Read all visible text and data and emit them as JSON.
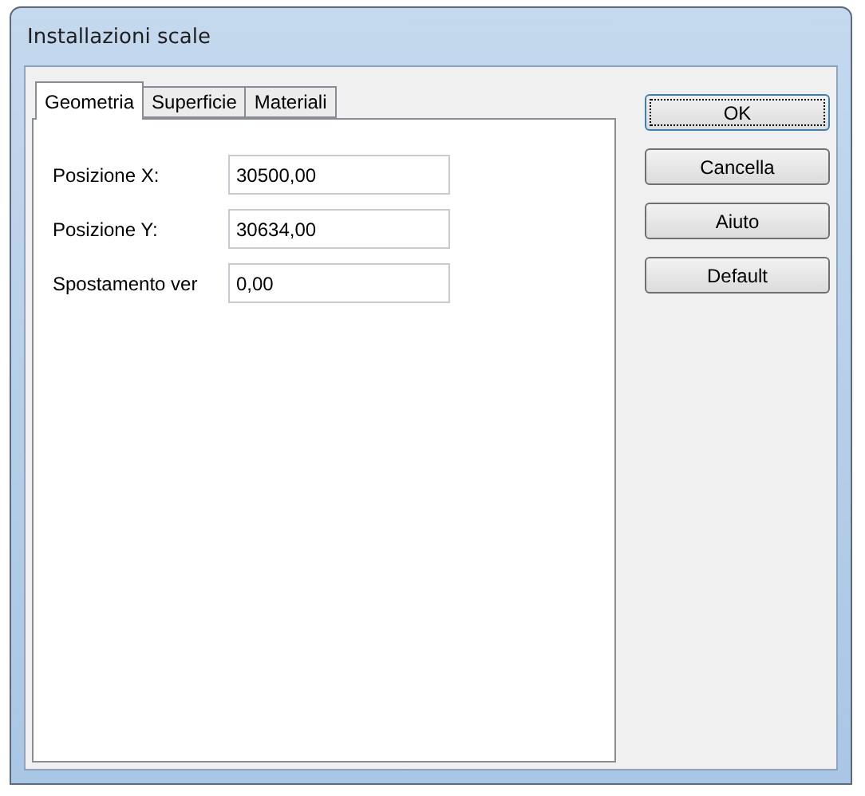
{
  "window": {
    "title": "Installazioni scale"
  },
  "tabs": [
    {
      "label": "Geometria",
      "selected": true
    },
    {
      "label": "Superficie",
      "selected": false
    },
    {
      "label": "Materiali",
      "selected": false
    }
  ],
  "fields": [
    {
      "label": "Posizione X:",
      "value": "30500,00"
    },
    {
      "label": "Posizione Y:",
      "value": "30634,00"
    },
    {
      "label": "Spostamento ver",
      "value": "0,00"
    }
  ],
  "buttons": [
    {
      "label": "OK",
      "focused": true
    },
    {
      "label": "Cancella",
      "focused": false
    },
    {
      "label": "Aiuto",
      "focused": false
    },
    {
      "label": "Default",
      "focused": false
    }
  ]
}
